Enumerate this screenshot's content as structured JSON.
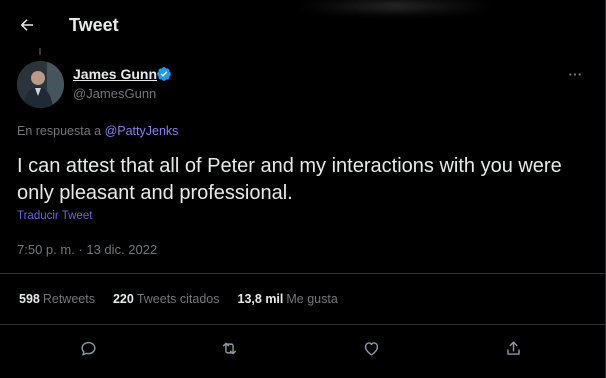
{
  "header": {
    "title": "Tweet"
  },
  "tweet": {
    "author_name": "James Gunn",
    "handle": "@JamesGunn",
    "reply_prefix": "En respuesta a",
    "reply_to": "@PattyJenks",
    "text": "I can attest that all of Peter and my interactions with you were only pleasant and professional.",
    "translate": "Traducir Tweet",
    "timestamp": "7:50 p. m. · 13 dic. 2022"
  },
  "stats": {
    "retweets_count": "598",
    "retweets_label": "Retweets",
    "quotes_count": "220",
    "quotes_label": "Tweets citados",
    "likes_count": "13,8 mil",
    "likes_label": "Me gusta"
  },
  "icons": {
    "back": "arrow-left-icon",
    "verified": "verified-badge-icon",
    "more": "more-horizontal-icon",
    "reply": "reply-icon",
    "retweet": "retweet-icon",
    "like": "heart-icon",
    "share": "share-icon"
  },
  "colors": {
    "background": "#000000",
    "text": "#e7e9ea",
    "secondary": "#71767b",
    "link": "#8b7cf6",
    "verified": "#1d9bf0",
    "divider": "#2f3336"
  }
}
